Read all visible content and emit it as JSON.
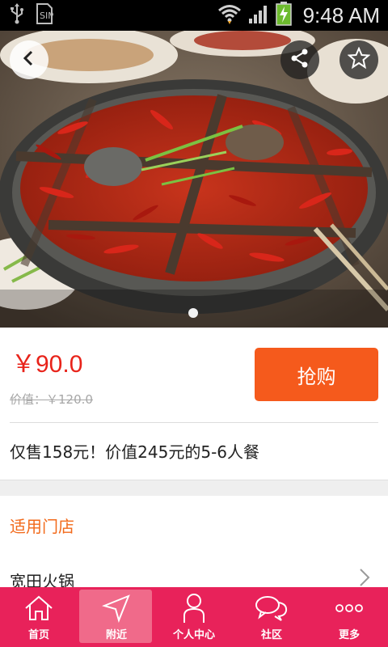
{
  "status_bar": {
    "time": "9:48 AM",
    "icons": [
      "usb-icon",
      "sim-card-icon",
      "wifi-icon",
      "signal-icon",
      "battery-charging-icon"
    ]
  },
  "hero": {
    "back_icon": "back-arrow-icon",
    "share_icon": "share-icon",
    "favorite_icon": "star-icon",
    "page_indicator": {
      "count": 1,
      "active": 1
    }
  },
  "deal": {
    "price": "￥90.0",
    "original_price": "价值：￥120.0",
    "buy_label": "抢购",
    "description": "仅售158元！价值245元的5-6人餐"
  },
  "stores": {
    "title": "适用门店",
    "items": [
      {
        "name": "宽田火锅"
      }
    ]
  },
  "bottom_nav": {
    "items": [
      {
        "label": "首页",
        "icon": "home-icon",
        "active": false
      },
      {
        "label": "附近",
        "icon": "navigation-arrow-icon",
        "active": true
      },
      {
        "label": "个人中心",
        "icon": "person-icon",
        "active": false
      },
      {
        "label": "社区",
        "icon": "chat-bubbles-icon",
        "active": false
      },
      {
        "label": "更多",
        "icon": "more-dots-icon",
        "active": false
      }
    ]
  },
  "colors": {
    "price_red": "#e8231a",
    "buy_orange": "#f55a1c",
    "section_title_orange": "#f26a1b",
    "nav_bg": "#e8225a",
    "nav_active": "#f06a8a"
  }
}
